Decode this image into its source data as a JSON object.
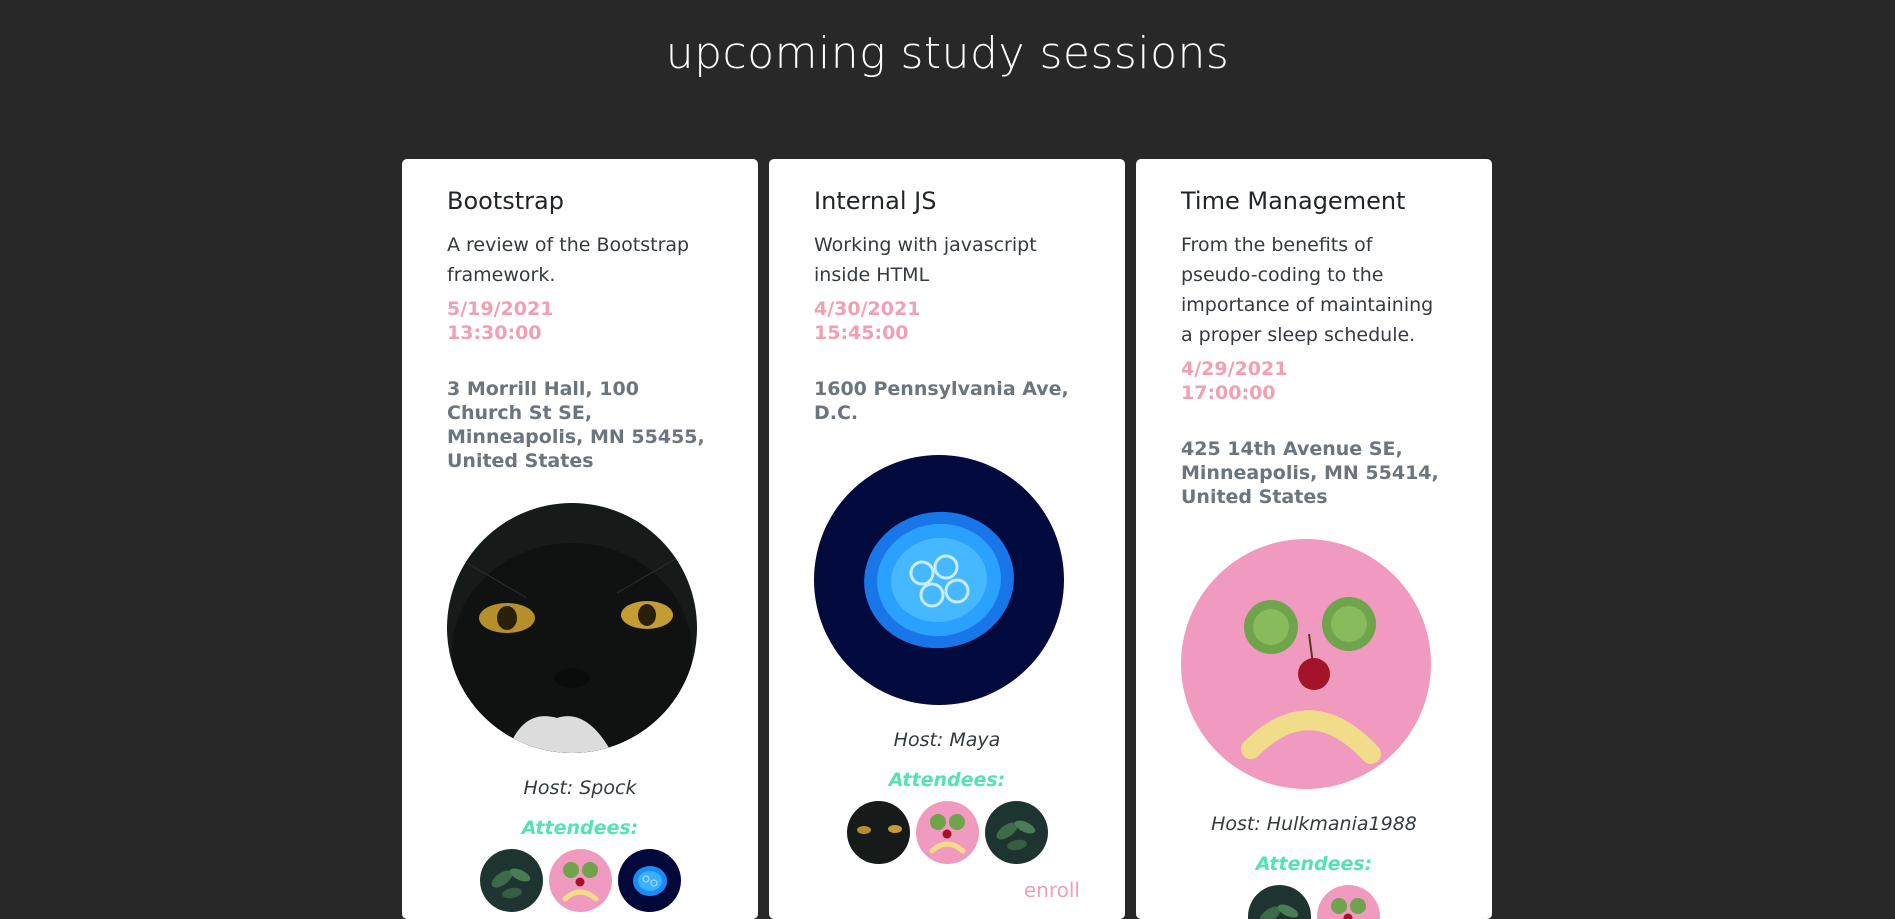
{
  "page": {
    "title": "upcoming study sessions"
  },
  "sessions": [
    {
      "title": "Bootstrap",
      "description": "A review of the Bootstrap framework.",
      "date": "5/19/2021",
      "time": "13:30:00",
      "address": "3 Morrill Hall, 100 Church St SE, Minneapolis, MN 55455, United States",
      "host_prefix": "Host: ",
      "host": "Spock",
      "host_photo": "black-cat",
      "attendees_label": "Attendees:",
      "attendees": [
        "leaves",
        "fruit-face",
        "jellyfish"
      ]
    },
    {
      "title": "Internal JS",
      "description": "Working with javascript inside HTML",
      "date": "4/30/2021",
      "time": "15:45:00",
      "address": "1600 Pennsylvania Ave, D.C.",
      "host_prefix": "Host: ",
      "host": "Maya",
      "host_photo": "jellyfish",
      "attendees_label": "Attendees:",
      "attendees": [
        "black-cat",
        "fruit-face",
        "leaves"
      ],
      "enroll_label": "enroll"
    },
    {
      "title": "Time Management",
      "description": "From the benefits of pseudo-coding to the importance of maintaining a proper sleep schedule.",
      "date": "4/29/2021",
      "time": "17:00:00",
      "address": "425 14th Avenue SE, Minneapolis, MN 55414, United States",
      "host_prefix": "Host: ",
      "host": "Hulkmania1988",
      "host_photo": "fruit-face",
      "attendees_label": "Attendees:",
      "attendees": [
        "leaves",
        "fruit-face"
      ]
    }
  ],
  "colors": {
    "background": "#282828",
    "card": "#ffffff",
    "accent_pink": "#f1a0b2",
    "accent_teal": "#52e3b7",
    "muted_gray": "#6c757d"
  }
}
